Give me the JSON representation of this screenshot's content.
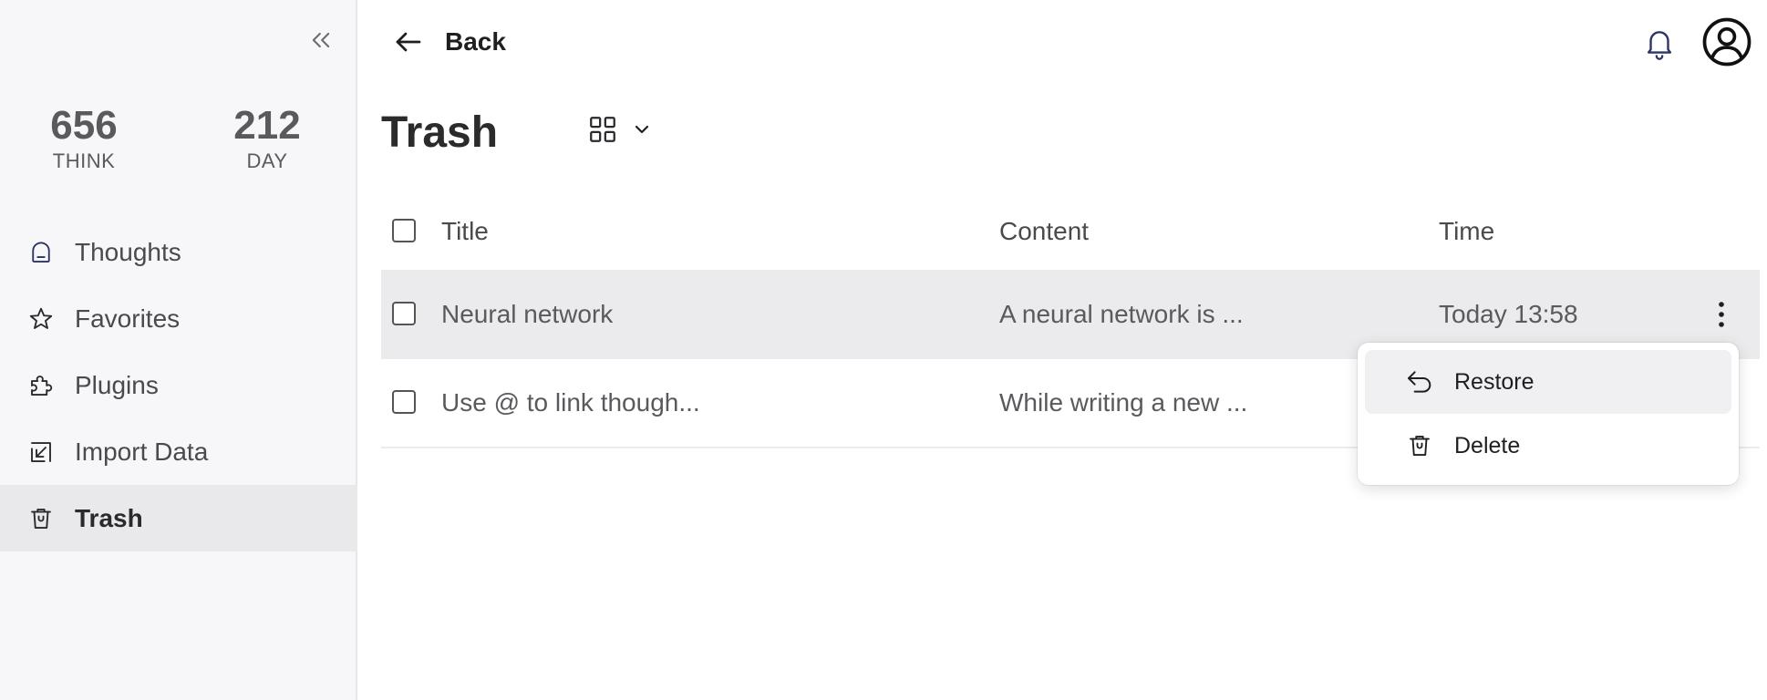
{
  "sidebar": {
    "collapse_icon": "double-chevron-left-icon",
    "stats": [
      {
        "value": "656",
        "label": "THINK"
      },
      {
        "value": "212",
        "label": "DAY"
      }
    ],
    "items": [
      {
        "label": "Thoughts",
        "icon": "thoughts-icon",
        "active": false
      },
      {
        "label": "Favorites",
        "icon": "star-icon",
        "active": false
      },
      {
        "label": "Plugins",
        "icon": "puzzle-icon",
        "active": false
      },
      {
        "label": "Import Data",
        "icon": "import-icon",
        "active": false
      },
      {
        "label": "Trash",
        "icon": "trash-icon",
        "active": true
      }
    ]
  },
  "topbar": {
    "back_label": "Back",
    "back_icon": "arrow-left-icon",
    "notification_icon": "bell-icon",
    "account_icon": "user-circle-icon"
  },
  "page": {
    "title": "Trash",
    "view_icon": "grid-icon"
  },
  "table": {
    "columns": [
      "Title",
      "Content",
      "Time"
    ],
    "rows": [
      {
        "title": "Neural network",
        "content": "A neural network is ...",
        "time": "Today 13:58"
      },
      {
        "title": "Use @ to link though...",
        "content": "While writing a new ...",
        "time": ""
      }
    ]
  },
  "menu": {
    "items": [
      {
        "label": "Restore",
        "icon": "undo-icon"
      },
      {
        "label": "Delete",
        "icon": "trash-icon"
      }
    ]
  },
  "colors": {
    "sidebar_bg": "#f7f7f9",
    "active_bg": "#e9e9eb",
    "row_hover_bg": "#ebebed",
    "text_primary": "#1f1f1f",
    "text_muted": "#5a5a5e"
  }
}
